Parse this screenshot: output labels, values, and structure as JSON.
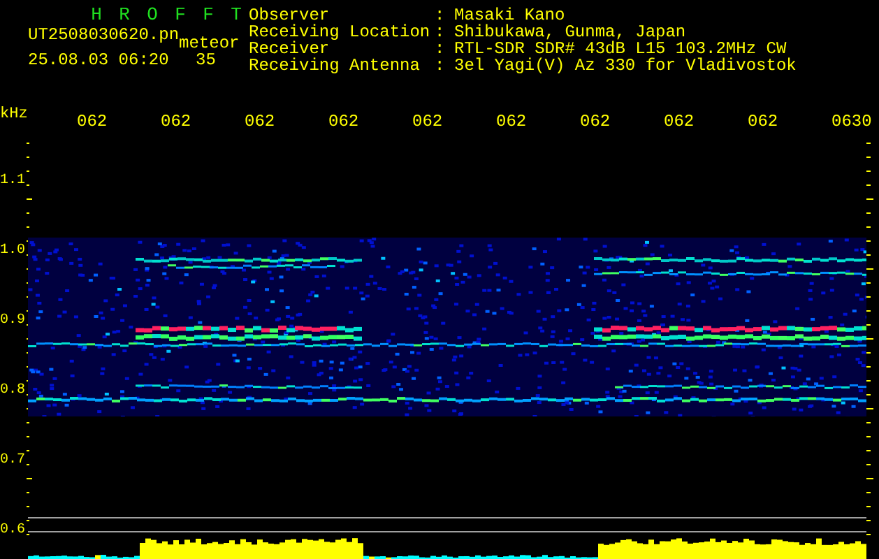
{
  "app_title_letters": [
    "H",
    "R",
    "O",
    "F",
    "F",
    "T"
  ],
  "file_name": "UT2508030620.pn",
  "mode": "meteor",
  "timestamp": "25.08.03 06:20",
  "count": "35",
  "info": [
    {
      "label": "Observer",
      "separator": ":",
      "value": "Masaki Kano"
    },
    {
      "label": "Receiving Location",
      "separator": ":",
      "value": "Shibukawa, Gunma, Japan"
    },
    {
      "label": "Receiver",
      "separator": ":",
      "value": "RTL-SDR SDR# 43dB L15 103.2MHz CW"
    },
    {
      "label": "Receiving Antenna",
      "separator": ":",
      "value": "3el Yagi(V) Az 330 for Vladivostok"
    }
  ],
  "chart": {
    "y_unit": "kHz",
    "y_ticks": [
      "1.1",
      "1.0",
      "0.9",
      "0.8",
      "0.7",
      "0.6"
    ],
    "time_labels": [
      "062",
      "062",
      "062",
      "062",
      "062",
      "062",
      "062",
      "062",
      "062",
      "0630"
    ]
  }
}
